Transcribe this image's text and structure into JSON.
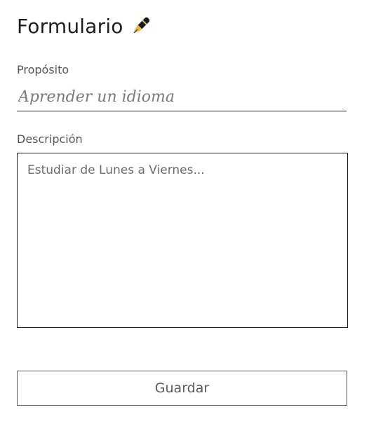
{
  "form": {
    "title": "Formulario",
    "title_icon": "fountain-pen-icon",
    "purpose": {
      "label": "Propósito",
      "placeholder": "Aprender un idioma",
      "value": ""
    },
    "description": {
      "label": "Descripción",
      "placeholder": "Estudiar de Lunes a Viernes...",
      "value": ""
    },
    "save_label": "Guardar"
  },
  "colors": {
    "text_dark": "#1e1e1e",
    "label_gray": "#555555",
    "border": "#1e1e1e",
    "button_border": "#5a5a5a",
    "pen_gold": "#e8b84a",
    "pen_black": "#1a1a1a"
  }
}
